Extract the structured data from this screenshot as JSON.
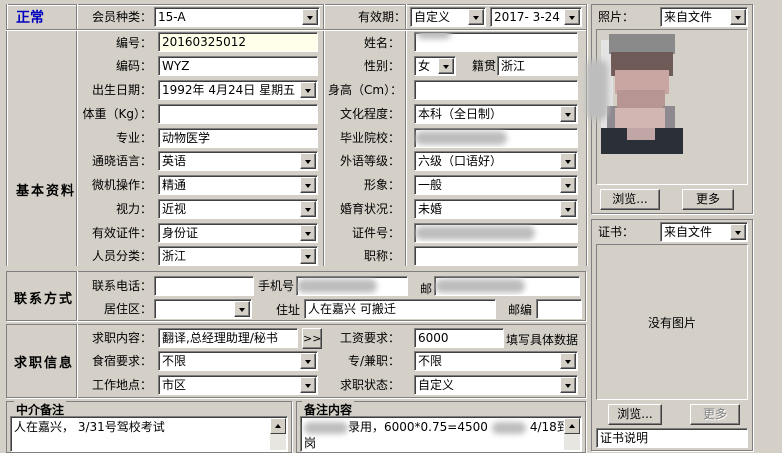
{
  "status": "正常",
  "member_type": {
    "label": "会员种类：",
    "value": "15-A"
  },
  "validity": {
    "label": "有效期：",
    "mode": "自定义",
    "date": "2017- 3-24"
  },
  "photo": {
    "label": "照片：",
    "source": "来自文件",
    "browse": "浏览...",
    "more": "更多"
  },
  "cert": {
    "label": "证书：",
    "source": "来自文件",
    "empty": "没有图片",
    "browse": "浏览...",
    "more": "更多",
    "caption": "证书说明"
  },
  "sections": {
    "basic": "基本资料",
    "contact": "联系方式",
    "job": "求职信息",
    "agency": "中介备注",
    "remark": "备注内容"
  },
  "basic": {
    "id_no": {
      "label": "编号：",
      "value": "20160325012"
    },
    "code": {
      "label": "编码：",
      "value": "WYZ"
    },
    "birth": {
      "label": "出生日期：",
      "value": "1992年 4月24日 星期五"
    },
    "weight": {
      "label": "体重（Kg）：",
      "value": ""
    },
    "major": {
      "label": "专业：",
      "value": "动物医学"
    },
    "lang": {
      "label": "通晓语言：",
      "value": "英语"
    },
    "pc": {
      "label": "微机操作：",
      "value": "精通"
    },
    "vision": {
      "label": "视力：",
      "value": "近视"
    },
    "doc": {
      "label": "有效证件：",
      "value": "身份证"
    },
    "category": {
      "label": "人员分类：",
      "value": "浙江"
    },
    "name": {
      "label": "姓名："
    },
    "gender": {
      "label": "性别：",
      "value": "女"
    },
    "native": {
      "label": "籍贯",
      "value": "浙江"
    },
    "height": {
      "label": "身高（Cm）：",
      "value": ""
    },
    "edu": {
      "label": "文化程度：",
      "value": "本科（全日制）"
    },
    "school": {
      "label": "毕业院校："
    },
    "lang_level": {
      "label": "外语等级：",
      "value": "六级（口语好）"
    },
    "image": {
      "label": "形象：",
      "value": "一般"
    },
    "marital": {
      "label": "婚育状况：",
      "value": "未婚"
    },
    "id_num": {
      "label": "证件号："
    },
    "title": {
      "label": "职称：",
      "value": ""
    }
  },
  "contact": {
    "phone": {
      "label": "联系电话："
    },
    "mobile": {
      "label": "手机号"
    },
    "district": {
      "label": "居住区："
    },
    "address": {
      "label": "住址",
      "value": "人在嘉兴 可搬迁"
    },
    "postcode": {
      "label": "邮编"
    },
    "email_prefix": "邮"
  },
  "job": {
    "content": {
      "label": "求职内容：",
      "value": "翻译,总经理助理/秘书",
      "btn": ">>"
    },
    "salary": {
      "label": "工资要求：",
      "value": "6000",
      "hint": "填写具体数据"
    },
    "board": {
      "label": "食宿要求：",
      "value": "不限"
    },
    "fulltime": {
      "label": "专/兼职：",
      "value": "不限"
    },
    "location": {
      "label": "工作地点：",
      "value": "市区"
    },
    "state": {
      "label": "求职状态：",
      "value": "自定义"
    }
  },
  "agency_note": "人在嘉兴， 3/31号驾校考试",
  "remark_note": {
    "part1": "录用，6000*0.75=4500",
    "part2": "4/18到",
    "part3": "岗"
  }
}
